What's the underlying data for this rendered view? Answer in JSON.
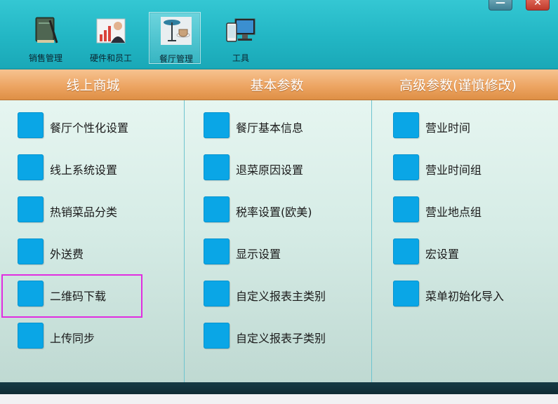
{
  "toolbar": {
    "items": [
      {
        "label": "销售管理",
        "icon": "ledger-book-icon"
      },
      {
        "label": "硬件和员工",
        "icon": "staff-chart-icon"
      },
      {
        "label": "餐厅管理",
        "icon": "restaurant-table-icon",
        "active": true
      },
      {
        "label": "工具",
        "icon": "devices-icon"
      }
    ]
  },
  "window": {
    "minimize_label": "—",
    "close_label": "✕"
  },
  "columns": [
    {
      "title": "线上商城",
      "items": [
        "餐厅个性化设置",
        "线上系统设置",
        "热销菜品分类",
        "外送费",
        "二维码下载",
        "上传同步"
      ]
    },
    {
      "title": "基本参数",
      "items": [
        "餐厅基本信息",
        "退菜原因设置",
        "税率设置(欧美)",
        "显示设置",
        "自定义报表主类别",
        "自定义报表子类别"
      ]
    },
    {
      "title": "高级参数(谨慎修改)",
      "items": [
        "营业时间",
        "营业时间组",
        "营业地点组",
        "宏设置",
        "菜单初始化导入"
      ]
    }
  ],
  "colors": {
    "toolbar": "#22b6c4",
    "header": "#eda563",
    "tile": "#0aa6e6",
    "highlight": "#e02ee0"
  }
}
